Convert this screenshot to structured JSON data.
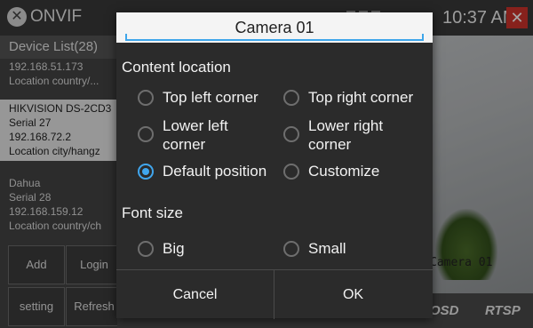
{
  "app": {
    "title": "ONVIF",
    "clock": "10:37 AM"
  },
  "device_list": {
    "header": "Device List(28)",
    "devices": [
      {
        "ip": "192.168.51.173",
        "location": "Location  country/..."
      },
      {
        "name": "HIKVISION DS-2CD3",
        "serial": "Serial  27",
        "ip": "192.168.72.2",
        "location": "Location  city/hangz"
      },
      {
        "name": "Dahua",
        "serial": "Serial  28",
        "ip": "192.168.159.12",
        "location": "Location  country/ch"
      }
    ],
    "buttons": {
      "add": "Add",
      "login": "Login",
      "setting": "setting",
      "refresh": "Refresh"
    }
  },
  "video": {
    "camera_label": "Camera  01",
    "osd": "OSD",
    "rtsp": "RTSP"
  },
  "dialog": {
    "title": "Camera 01",
    "content_location_label": "Content location",
    "options": {
      "top_left": "Top left corner",
      "top_right": "Top right corner",
      "lower_left_1": "Lower left",
      "lower_left_2": "corner",
      "lower_right_1": "Lower right",
      "lower_right_2": "corner",
      "default_position": "Default position",
      "customize": "Customize"
    },
    "selected_location": "Default position",
    "font_size_label": "Font size",
    "font_options": {
      "big": "Big",
      "small": "Small"
    },
    "selected_font_size": null,
    "cancel": "Cancel",
    "ok": "OK"
  },
  "colors": {
    "accent": "#40a6ee",
    "close": "#d0342c"
  }
}
